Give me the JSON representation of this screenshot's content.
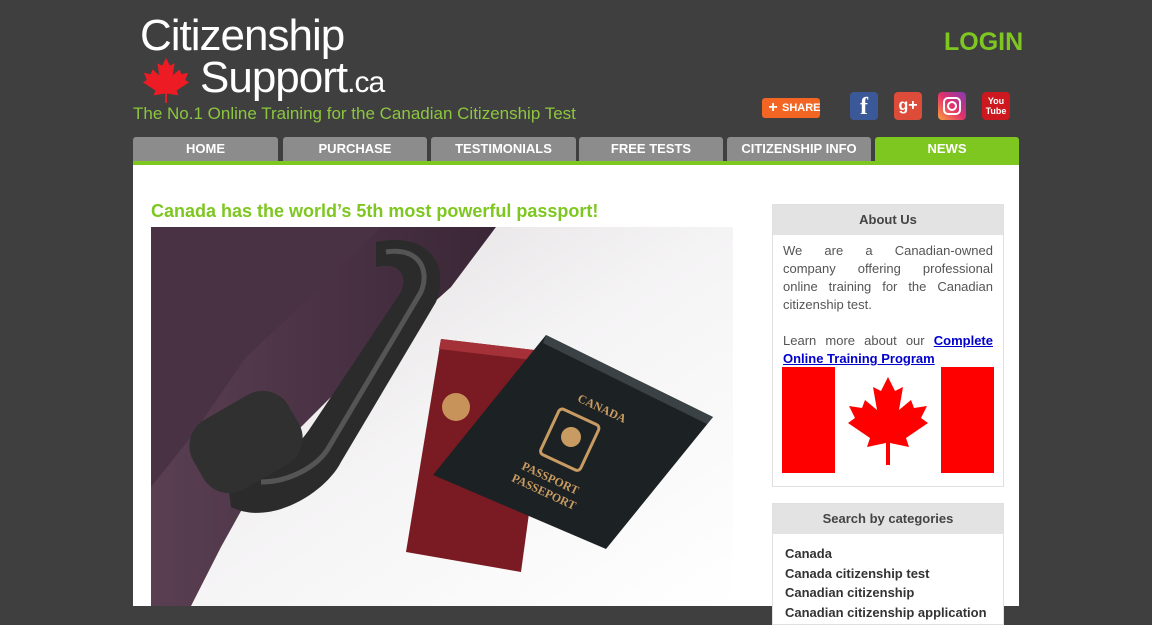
{
  "brand": {
    "line1": "Citizenship",
    "line2": "Support",
    "tld": ".ca",
    "tagline": "The No.1 Online Training for the Canadian Citizenship Test"
  },
  "header": {
    "login_label": "LOGIN",
    "share_label": "SHARE",
    "social": [
      {
        "name": "facebook-icon",
        "glyph": "f"
      },
      {
        "name": "google-plus-icon",
        "glyph": "g+"
      },
      {
        "name": "instagram-icon",
        "glyph": ""
      },
      {
        "name": "youtube-icon",
        "glyph": "You Tube"
      }
    ]
  },
  "nav": {
    "tabs": [
      {
        "label": "HOME",
        "active": false
      },
      {
        "label": "PURCHASE",
        "active": false
      },
      {
        "label": "TESTIMONIALS",
        "active": false
      },
      {
        "label": "FREE TESTS",
        "active": false
      },
      {
        "label": "CITIZENSHIP INFO",
        "active": false
      },
      {
        "label": "NEWS",
        "active": true
      }
    ]
  },
  "post": {
    "title": "Canada has the world’s 5th most powerful passport!",
    "image_alt": "Canadian passports beside a suitcase handle",
    "passport_text": [
      "CANADA",
      "PASSPORT",
      "PASSEPORT"
    ]
  },
  "sidebar": {
    "about": {
      "heading": "About Us",
      "text": "We are a Canadian-owned company offering professional online training for the Canadian citizenship test.",
      "learn_prefix": "Learn more about our",
      "link_label": "Complete Online Training Program"
    },
    "categories": {
      "heading": "Search by categories",
      "items": [
        "Canada",
        "Canada citizenship test",
        "Canadian citizenship",
        "Canadian citizenship application"
      ]
    }
  },
  "colors": {
    "background": "#3f3f3f",
    "accent_green": "#7ec721",
    "tab_grey": "#8c8c8c",
    "link_blue": "#0000cc",
    "flag_red": "#ff0000"
  }
}
